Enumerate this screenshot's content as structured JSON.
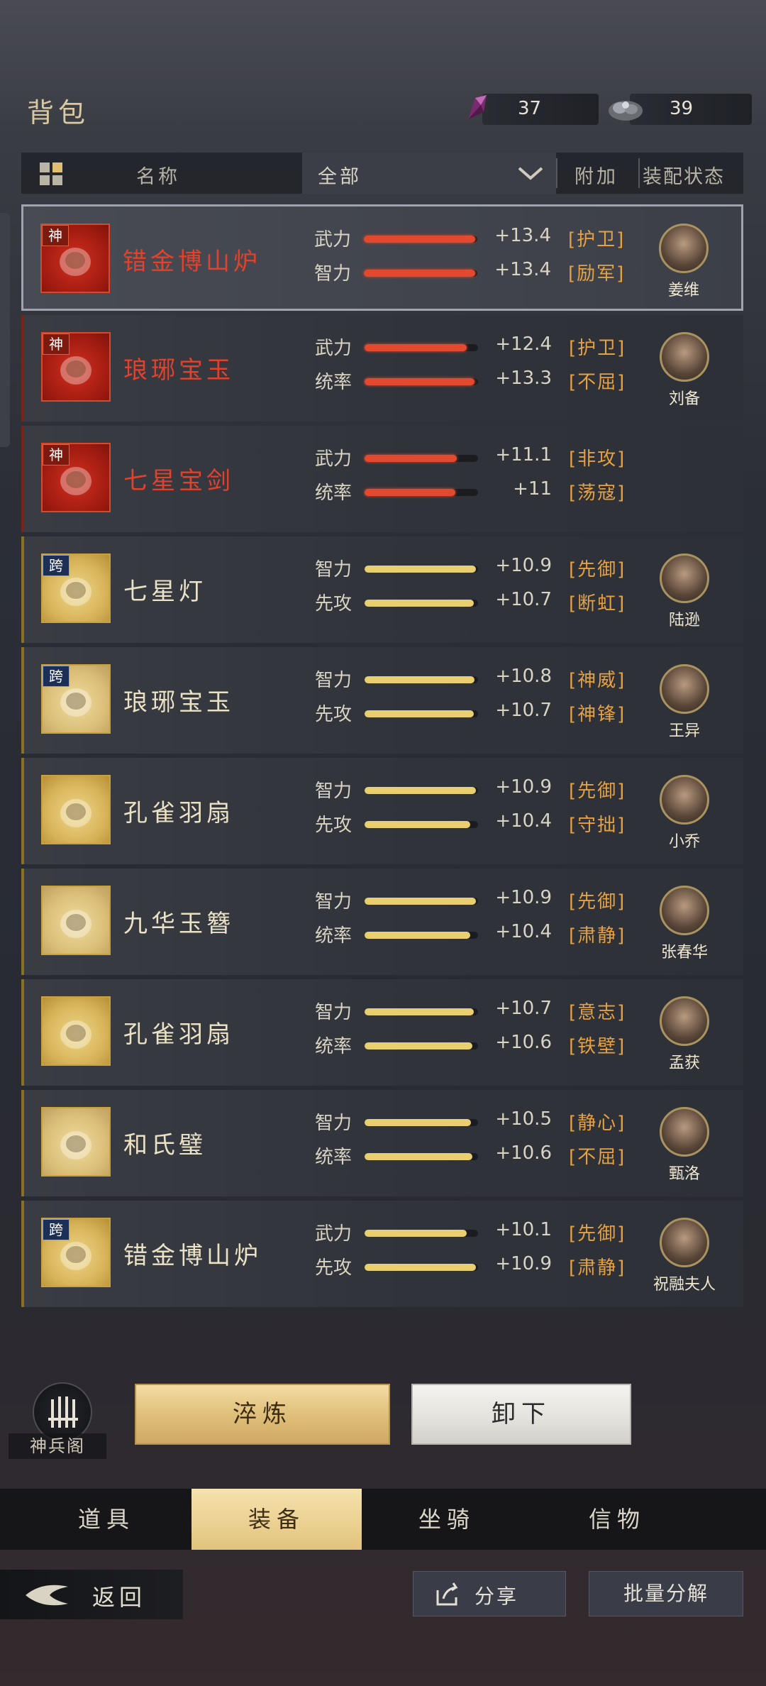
{
  "header": {
    "title": "背包",
    "currency": [
      {
        "icon": "purple-crystal-icon",
        "value": "37"
      },
      {
        "icon": "silver-ore-icon",
        "value": "39"
      }
    ]
  },
  "table_header": {
    "name_label": "名称",
    "filter_value": "全部",
    "extra_label": "附加",
    "status_label": "装配状态"
  },
  "items": [
    {
      "tag": "神",
      "name": "错金博山炉",
      "name_color": "red",
      "stats": [
        {
          "label": "武力",
          "value": "+13.4",
          "fill": 0.98,
          "trait": "[护卫]"
        },
        {
          "label": "智力",
          "value": "+13.4",
          "fill": 0.98,
          "trait": "[励军]"
        }
      ],
      "hero": "姜维",
      "bar_color": "red"
    },
    {
      "tag": "神",
      "name": "琅琊宝玉",
      "name_color": "red",
      "stats": [
        {
          "label": "武力",
          "value": "+12.4",
          "fill": 0.9,
          "trait": "[护卫]"
        },
        {
          "label": "统率",
          "value": "+13.3",
          "fill": 0.97,
          "trait": "[不屈]"
        }
      ],
      "hero": "刘备",
      "bar_color": "red"
    },
    {
      "tag": "神",
      "name": "七星宝剑",
      "name_color": "red",
      "stats": [
        {
          "label": "武力",
          "value": "+11.1",
          "fill": 0.81,
          "trait": "[非攻]"
        },
        {
          "label": "统率",
          "value": "+11",
          "fill": 0.8,
          "trait": "[荡寇]"
        }
      ],
      "hero": "",
      "bar_color": "red"
    },
    {
      "tag": "跨",
      "name": "七星灯",
      "name_color": "cream",
      "stats": [
        {
          "label": "智力",
          "value": "+10.9",
          "fill": 0.98,
          "trait": "[先御]"
        },
        {
          "label": "先攻",
          "value": "+10.7",
          "fill": 0.96,
          "trait": "[断虹]"
        }
      ],
      "hero": "陆逊",
      "bar_color": "yellow"
    },
    {
      "tag": "跨",
      "name": "琅琊宝玉",
      "name_color": "cream",
      "stats": [
        {
          "label": "智力",
          "value": "+10.8",
          "fill": 0.97,
          "trait": "[神威]"
        },
        {
          "label": "先攻",
          "value": "+10.7",
          "fill": 0.96,
          "trait": "[神锋]"
        }
      ],
      "hero": "王异",
      "bar_color": "yellow"
    },
    {
      "tag": "",
      "name": "孔雀羽扇",
      "name_color": "cream",
      "stats": [
        {
          "label": "智力",
          "value": "+10.9",
          "fill": 0.98,
          "trait": "[先御]"
        },
        {
          "label": "先攻",
          "value": "+10.4",
          "fill": 0.93,
          "trait": "[守拙]"
        }
      ],
      "hero": "小乔",
      "bar_color": "yellow"
    },
    {
      "tag": "",
      "name": "九华玉簪",
      "name_color": "cream",
      "stats": [
        {
          "label": "智力",
          "value": "+10.9",
          "fill": 0.98,
          "trait": "[先御]"
        },
        {
          "label": "统率",
          "value": "+10.4",
          "fill": 0.93,
          "trait": "[肃静]"
        }
      ],
      "hero": "张春华",
      "bar_color": "yellow"
    },
    {
      "tag": "",
      "name": "孔雀羽扇",
      "name_color": "cream",
      "stats": [
        {
          "label": "智力",
          "value": "+10.7",
          "fill": 0.96,
          "trait": "[意志]"
        },
        {
          "label": "统率",
          "value": "+10.6",
          "fill": 0.95,
          "trait": "[铁壁]"
        }
      ],
      "hero": "孟获",
      "bar_color": "yellow"
    },
    {
      "tag": "",
      "name": "和氏璧",
      "name_color": "cream",
      "stats": [
        {
          "label": "智力",
          "value": "+10.5",
          "fill": 0.94,
          "trait": "[静心]"
        },
        {
          "label": "统率",
          "value": "+10.6",
          "fill": 0.95,
          "trait": "[不屈]"
        }
      ],
      "hero": "甄洛",
      "bar_color": "yellow"
    },
    {
      "tag": "跨",
      "name": "错金博山炉",
      "name_color": "cream",
      "stats": [
        {
          "label": "武力",
          "value": "+10.1",
          "fill": 0.9,
          "trait": "[先御]"
        },
        {
          "label": "先攻",
          "value": "+10.9",
          "fill": 0.98,
          "trait": "[肃静]"
        }
      ],
      "hero": "祝融夫人",
      "bar_color": "yellow"
    }
  ],
  "actions": {
    "shenbing_label": "神兵阁",
    "refine_label": "淬炼",
    "unequip_label": "卸下"
  },
  "tabs": [
    {
      "label": "道具",
      "active": false
    },
    {
      "label": "装备",
      "active": true
    },
    {
      "label": "坐骑",
      "active": false
    },
    {
      "label": "信物",
      "active": false
    }
  ],
  "footer": {
    "back_label": "返回",
    "share_label": "分享",
    "batch_label": "批量分解"
  }
}
